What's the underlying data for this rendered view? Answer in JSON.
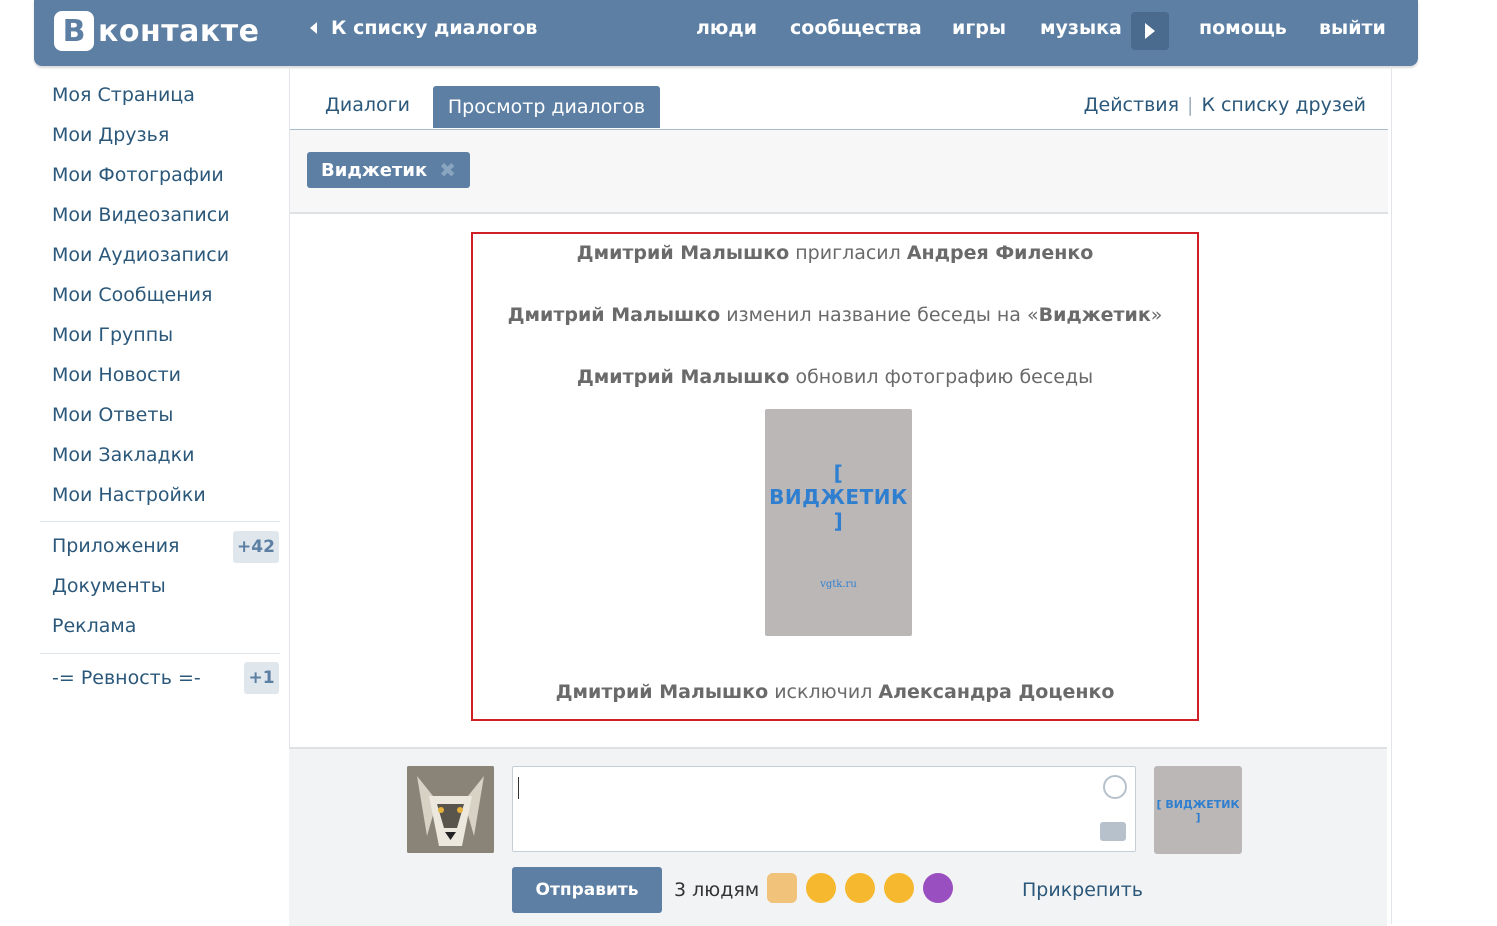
{
  "header": {
    "logo_letter": "В",
    "logo_text": "контакте",
    "back_link": "К списку диалогов",
    "nav": [
      "люди",
      "сообщества",
      "игры",
      "музыка",
      "помощь",
      "выйти"
    ]
  },
  "sidebar": {
    "items": [
      "Моя Страница",
      "Мои Друзья",
      "Мои Фотографии",
      "Мои Видеозаписи",
      "Мои Аудиозаписи",
      "Мои Сообщения",
      "Мои Группы",
      "Мои Новости",
      "Мои Ответы",
      "Мои Закладки",
      "Мои Настройки"
    ],
    "apps": {
      "label": "Приложения",
      "badge": "+42"
    },
    "documents": "Документы",
    "ads": "Реклама",
    "group": {
      "label": "-= Ревность =-",
      "badge": "+1"
    }
  },
  "tabs": {
    "dialogs": "Диалоги",
    "view": "Просмотр диалогов",
    "actions": "Действия",
    "separator": "|",
    "friends": "К списку друзей"
  },
  "filter": {
    "chip_label": "Виджетик",
    "chip_close": "✖"
  },
  "messages": [
    {
      "actor": "Дмитрий Малышко",
      "action": " пригласил ",
      "target": "Андрея Филенко"
    },
    {
      "actor": "Дмитрий Малышко",
      "action": " изменил название беседы на «",
      "target": "Виджетик",
      "suffix": "»"
    },
    {
      "actor": "Дмитрий Малышко",
      "action": " обновил фотографию беседы",
      "target": ""
    },
    {
      "actor": "Дмитрий Малышко",
      "action": " исключил ",
      "target": "Александра Доценко"
    }
  ],
  "photo": {
    "title": "[ ВИДЖЕТИК ]",
    "url": "vgtk.ru"
  },
  "composer": {
    "send": "Отправить",
    "recipients": "3 людям",
    "attach": "Прикрепить",
    "thumb_label": "[ ВИДЖЕТИК ]"
  },
  "colors": {
    "brand": "#5c7fa3",
    "highlight": "#d11f26",
    "link": "#2b587a"
  }
}
